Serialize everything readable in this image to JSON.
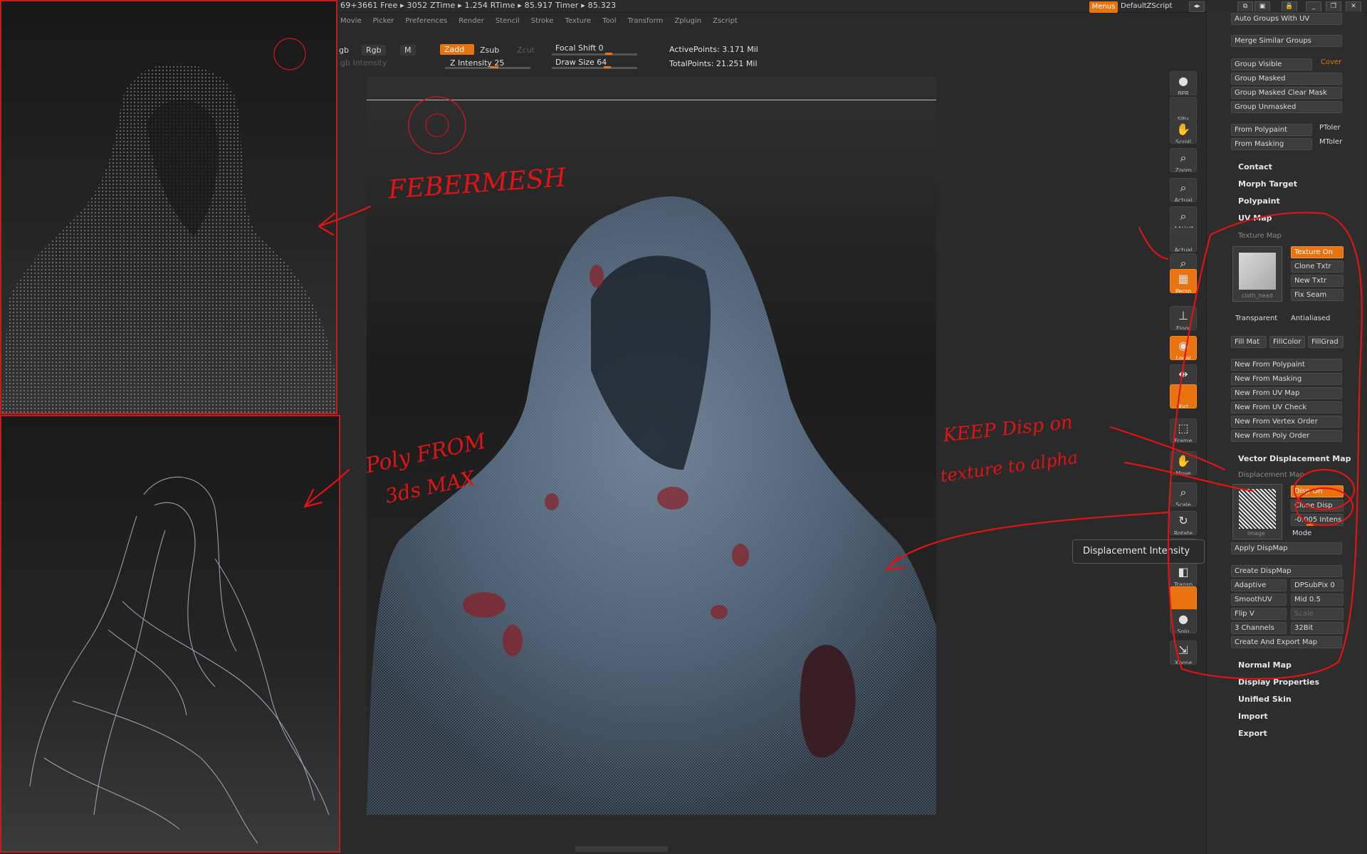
{
  "status": {
    "text": "69+3661  Free ▸ 3052  ZTime ▸ 1.254  RTime ▸ 85.917  Timer ▸ 85.323"
  },
  "menubar": {
    "items": [
      "Movie",
      "Picker",
      "Preferences",
      "Render",
      "Stencil",
      "Stroke",
      "Texture",
      "Tool",
      "Transform",
      "Zplugin",
      "Zscript"
    ],
    "menus_btn": "Menus",
    "script_label": "DefaultZScript"
  },
  "brush": {
    "rgb_short": "gb",
    "rgb": "Rgb",
    "m": "M",
    "zadd": "Zadd",
    "zsub": "Zsub",
    "zcut": "Zcut",
    "rgb_intensity": "gb Intensity",
    "z_intensity": "Z Intensity 25",
    "focal_shift": "Focal Shift 0",
    "draw_size": "Draw Size 64",
    "active_points": "ActivePoints: 3.171  Mil",
    "total_points": "TotalPoints: 21.251  Mil",
    "z_intensity_value": 25,
    "draw_size_value": 64
  },
  "shelf": [
    {
      "label": "BPR",
      "glyph": "●",
      "on": false
    },
    {
      "label": "SPix",
      "glyph": "",
      "on": false
    },
    {
      "label": "Scroll",
      "glyph": "✋",
      "on": false
    },
    {
      "label": "Zoom",
      "glyph": "⌕",
      "on": false
    },
    {
      "label": "Actual",
      "glyph": "⌕",
      "on": false
    },
    {
      "label": "AAHalf",
      "glyph": "⌕",
      "on": false
    },
    {
      "label": "Actual",
      "glyph": "",
      "on": false
    },
    {
      "label": "AAHalf",
      "glyph": "⌕",
      "on": false
    },
    {
      "label": "Persp",
      "glyph": "▦",
      "on": true
    },
    {
      "label": "Floor",
      "glyph": "⊥",
      "on": false
    },
    {
      "label": "Local",
      "glyph": "◉",
      "on": true
    },
    {
      "label": "LSym",
      "glyph": "⇹",
      "on": false
    },
    {
      "label": "Xyz",
      "glyph": "",
      "on": true
    },
    {
      "label": "Frame",
      "glyph": "⬚",
      "on": false
    },
    {
      "label": "Move",
      "glyph": "✋",
      "on": false
    },
    {
      "label": "Scale",
      "glyph": "⌕",
      "on": false
    },
    {
      "label": "Rotate",
      "glyph": "↻",
      "on": false
    },
    {
      "label": "PolyF",
      "glyph": "▦",
      "on": false
    },
    {
      "label": "Transp",
      "glyph": "◧",
      "on": false
    },
    {
      "label": "",
      "glyph": "",
      "on": true
    },
    {
      "label": "Solo",
      "glyph": "●",
      "on": false
    },
    {
      "label": "Xpose",
      "glyph": "⇲",
      "on": false
    }
  ],
  "palette": {
    "auto_groups_uv": "Auto Groups With UV",
    "merge_similar": "Merge Similar Groups",
    "group_visible": "Group Visible",
    "coverage": "Cover",
    "group_masked": "Group Masked",
    "group_masked_clear": "Group Masked Clear Mask",
    "group_unmasked": "Group Unmasked",
    "from_polypaint": "From Polypaint",
    "ptoler": "PToler",
    "from_masking": "From Masking",
    "mtoler": "MToler",
    "contact": "Contact",
    "morph_target": "Morph Target",
    "polypaint": "Polypaint",
    "uv_map": "UV Map",
    "texture_map": "Texture Map",
    "texture_on": "Texture On",
    "clone_txtr": "Clone Txtr",
    "new_txtr": "New Txtr",
    "fix_seam": "Fix Seam",
    "thumb_name": "cloth_head",
    "transparent": "Transparent",
    "antialiased": "Antialiased",
    "fill_mat": "Fill Mat",
    "fill_color": "FillColor",
    "fill_grad": "FillGrad",
    "new_from_polypaint": "New From Polypaint",
    "new_from_masking": "New From Masking",
    "new_from_uvmap": "New From UV Map",
    "new_from_uvcheck": "New From UV Check",
    "new_from_vertex": "New From Vertex Order",
    "new_from_poly": "New From Poly Order",
    "vector_disp": "Vector Displacement Map",
    "disp_map": "Displacement Map",
    "disp_on": "Disp On",
    "clone_disp": "Clone Disp",
    "intensity": "-0.005 Intens",
    "mode": "Mode",
    "image": "image",
    "apply_dispmap": "Apply DispMap",
    "create_dispmap": "Create DispMap",
    "adaptive": "Adaptive",
    "dpsubpix": "DPSubPix 0",
    "smoothuv": "SmoothUV",
    "mid": "Mid 0.5",
    "flip_v": "Flip V",
    "scale": "Scale",
    "three_channels": "3 Channels",
    "bit32": "32Bit",
    "create_export": "Create And Export Map",
    "normal_map": "Normal Map",
    "display_props": "Display Properties",
    "unified_skin": "Unified Skin",
    "import": "Import",
    "export": "Export"
  },
  "tooltip": "Displacement Intensity",
  "annotations": {
    "fibermesh": "FEBERMESH",
    "poly_line1": "Poly FROM",
    "poly_line2": "3ds MAX",
    "keep_line1": "KEEP   Disp on",
    "keep_line2": "texture    to alpha"
  },
  "colors": {
    "accent": "#e8730f",
    "annotation_red": "#e01414",
    "panel_border": "#c01d1d"
  }
}
